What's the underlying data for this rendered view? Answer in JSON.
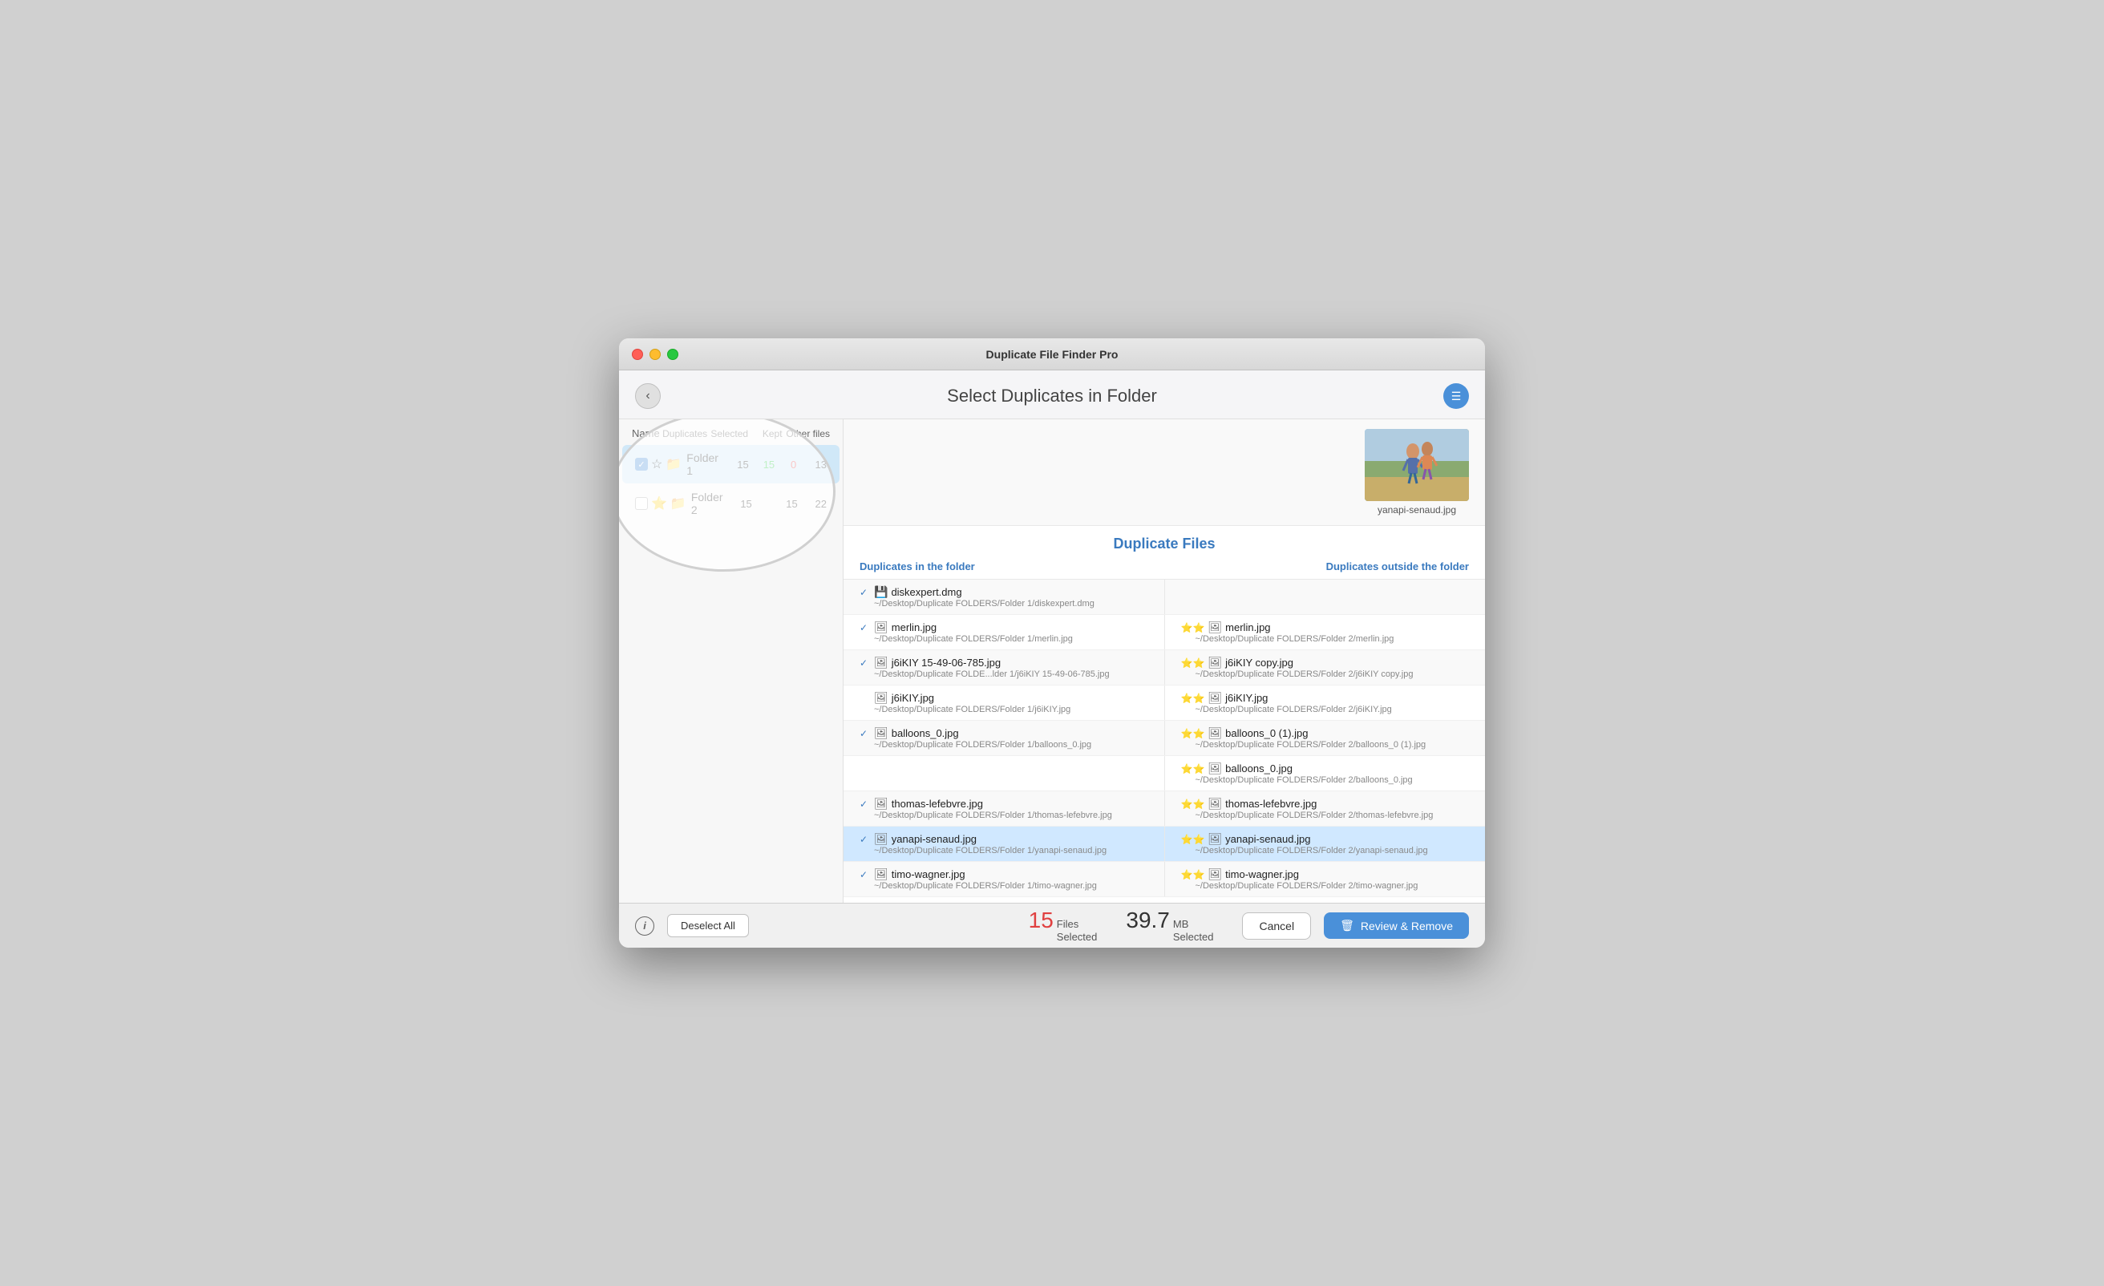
{
  "window": {
    "title": "Duplicate File Finder Pro"
  },
  "header": {
    "title": "Select Duplicates in Folder",
    "back_label": "‹",
    "menu_label": "☰"
  },
  "folder_table": {
    "col_name": "Name",
    "col_duplicates": "Duplicates",
    "col_selected": "Selected",
    "col_kept": "Kept",
    "col_other": "Other files",
    "folders": [
      {
        "id": "folder1",
        "name": "Folder 1",
        "checked": true,
        "starred": false,
        "duplicates": "15",
        "selected": "15",
        "kept": "0",
        "other": "13",
        "selected_is_green": true,
        "kept_is_red": true
      },
      {
        "id": "folder2",
        "name": "Folder 2",
        "checked": false,
        "starred": true,
        "duplicates": "15",
        "selected": "",
        "kept": "15",
        "other": "22",
        "selected_is_green": false,
        "kept_is_red": false
      }
    ]
  },
  "preview": {
    "filename": "yanapi-senaud.jpg"
  },
  "duplicate_files": {
    "section_title": "Duplicate Files",
    "col_left": "Duplicates in the folder",
    "col_right": "Duplicates outside the folder",
    "groups": [
      {
        "left": {
          "checked": true,
          "filename": "diskexpert.dmg",
          "filepath": "~/Desktop/Duplicate FOLDERS/Folder 1/diskexpert.dmg"
        },
        "right": null
      },
      {
        "left": {
          "checked": true,
          "filename": "merlin.jpg",
          "filepath": "~/Desktop/Duplicate FOLDERS/Folder 1/merlin.jpg"
        },
        "right": {
          "filename": "merlin.jpg",
          "filepath": "~/Desktop/Duplicate FOLDERS/Folder 2/merlin.jpg",
          "starred": true
        }
      },
      {
        "left": {
          "checked": true,
          "filename": "j6iKIY 15-49-06-785.jpg",
          "filepath": "~/Desktop/Duplicate FOLDE...lder 1/j6iKIY 15-49-06-785.jpg"
        },
        "right": {
          "filename": "j6iKIY copy.jpg",
          "filepath": "~/Desktop/Duplicate FOLDERS/Folder 2/j6iKIY copy.jpg",
          "starred": true
        }
      },
      {
        "left": {
          "checked": false,
          "filename": "j6iKIY.jpg",
          "filepath": "~/Desktop/Duplicate FOLDERS/Folder 1/j6iKIY.jpg"
        },
        "right": {
          "filename": "j6iKIY.jpg",
          "filepath": "~/Desktop/Duplicate FOLDERS/Folder 2/j6iKIY.jpg",
          "starred": true
        }
      },
      {
        "left": {
          "checked": true,
          "filename": "balloons_0.jpg",
          "filepath": "~/Desktop/Duplicate FOLDERS/Folder 1/balloons_0.jpg"
        },
        "right": {
          "filename": "balloons_0 (1).jpg",
          "filepath": "~/Desktop/Duplicate FOLDERS/Folder 2/balloons_0 (1).jpg",
          "starred": true
        }
      },
      {
        "left": null,
        "right": {
          "filename": "balloons_0.jpg",
          "filepath": "~/Desktop/Duplicate FOLDERS/Folder 2/balloons_0.jpg",
          "starred": true
        }
      },
      {
        "left": {
          "checked": true,
          "filename": "thomas-lefebvre.jpg",
          "filepath": "~/Desktop/Duplicate FOLDERS/Folder 1/thomas-lefebvre.jpg"
        },
        "right": {
          "filename": "thomas-lefebvre.jpg",
          "filepath": "~/Desktop/Duplicate FOLDERS/Folder 2/thomas-lefebvre.jpg",
          "starred": true
        }
      },
      {
        "highlighted": true,
        "left": {
          "checked": true,
          "filename": "yanapi-senaud.jpg",
          "filepath": "~/Desktop/Duplicate FOLDERS/Folder 1/yanapi-senaud.jpg"
        },
        "right": {
          "filename": "yanapi-senaud.jpg",
          "filepath": "~/Desktop/Duplicate FOLDERS/Folder 2/yanapi-senaud.jpg",
          "starred": true
        }
      },
      {
        "left": {
          "checked": true,
          "filename": "timo-wagner.jpg",
          "filepath": "~/Desktop/Duplicate FOLDERS/Folder 1/timo-wagner.jpg"
        },
        "right": {
          "filename": "timo-wagner.jpg",
          "filepath": "~/Desktop/Duplicate FOLDERS/Folder 2/timo-wagner.jpg",
          "starred": true
        }
      }
    ]
  },
  "bottom_bar": {
    "info_label": "i",
    "deselect_all": "Deselect All",
    "files_count": "15",
    "files_label_line1": "Files",
    "files_label_line2": "Selected",
    "mb_count": "39.7",
    "mb_label_line1": "MB",
    "mb_label_line2": "Selected",
    "cancel_label": "Cancel",
    "review_label": "Review & Remove"
  }
}
